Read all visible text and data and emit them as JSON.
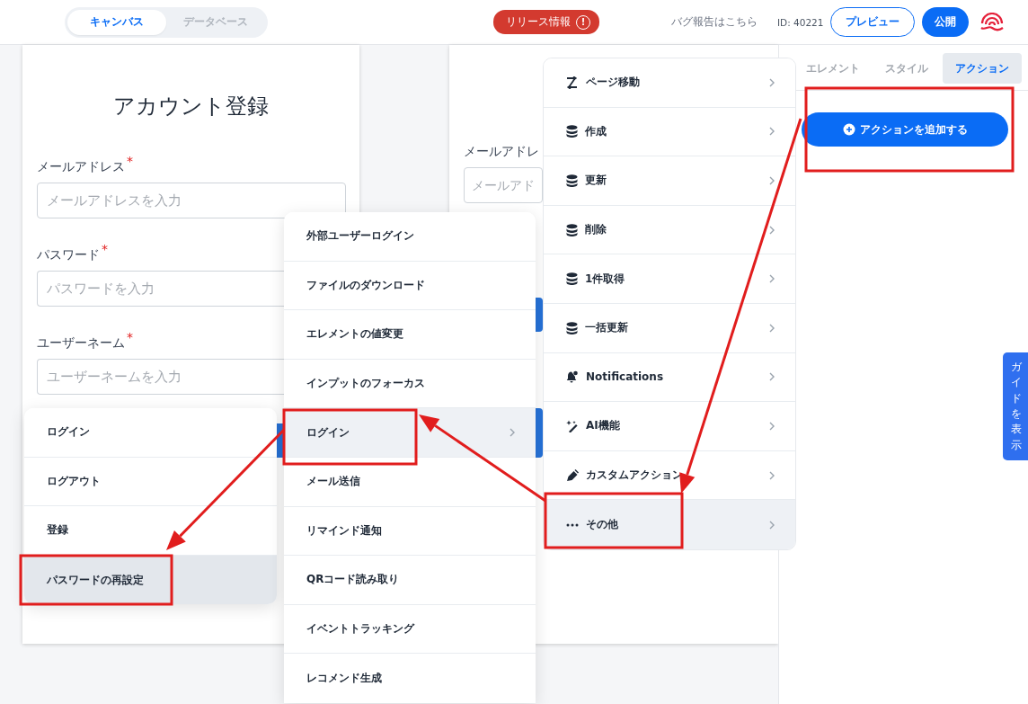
{
  "header": {
    "tabs": [
      {
        "label": "キャンバス",
        "selected": true
      },
      {
        "label": "データベース",
        "selected": false
      }
    ],
    "release_badge": {
      "label": "リリース情報",
      "icon": "!"
    },
    "bug_link": "バグ報告はこちら",
    "id_label": "ID: 40221",
    "buttons": [
      {
        "label": "プレビュー",
        "kind": "outline"
      },
      {
        "label": "公開",
        "kind": "primary"
      }
    ]
  },
  "canvas": {
    "form_card": {
      "title": "アカウント登録",
      "fields": [
        {
          "label": "メールアドレス",
          "required_mark": "*",
          "placeholder": "メールアドレスを入力"
        },
        {
          "label": "パスワード",
          "required_mark": "*",
          "placeholder": "パスワードを入力"
        },
        {
          "label": "ユーザーネーム",
          "required_mark": "*",
          "placeholder": "ユーザーネームを入力"
        }
      ]
    },
    "second_card": {
      "fields": [
        {
          "label": "メールアドレ",
          "placeholder": "メールアド"
        }
      ]
    }
  },
  "action_menu": {
    "items": [
      {
        "label": "ページ移動",
        "kind": "route",
        "selected": false
      },
      {
        "label": "作成",
        "kind": "database",
        "selected": false
      },
      {
        "label": "更新",
        "kind": "database",
        "selected": false
      },
      {
        "label": "削除",
        "kind": "database",
        "selected": false
      },
      {
        "label": "1件取得",
        "kind": "database",
        "selected": false
      },
      {
        "label": "一括更新",
        "kind": "database",
        "selected": false
      },
      {
        "label": "Notifications",
        "kind": "bell",
        "selected": false
      },
      {
        "label": "AI機能",
        "kind": "ai",
        "selected": false
      },
      {
        "label": "カスタムアクション",
        "kind": "custom",
        "selected": false
      },
      {
        "label": "その他",
        "kind": "more",
        "selected": true
      }
    ]
  },
  "submenu": {
    "items": [
      {
        "label": "外部ユーザーログイン",
        "selected": false,
        "has_submenu": false
      },
      {
        "label": "ファイルのダウンロード",
        "selected": false,
        "has_submenu": false
      },
      {
        "label": "エレメントの値変更",
        "selected": false,
        "has_submenu": false
      },
      {
        "label": "インプットのフォーカス",
        "selected": false,
        "has_submenu": false
      },
      {
        "label": "ログイン",
        "selected": true,
        "has_submenu": true
      },
      {
        "label": "メール送信",
        "selected": false,
        "has_submenu": false
      },
      {
        "label": "リマインド通知",
        "selected": false,
        "has_submenu": false
      },
      {
        "label": "QRコード読み取り",
        "selected": false,
        "has_submenu": false
      },
      {
        "label": "イベントトラッキング",
        "selected": false,
        "has_submenu": false
      },
      {
        "label": "レコメンド生成",
        "selected": false,
        "has_submenu": false
      }
    ]
  },
  "login_menu": {
    "items": [
      {
        "label": "ログイン",
        "selected": false
      },
      {
        "label": "ログアウト",
        "selected": false
      },
      {
        "label": "登録",
        "selected": false
      },
      {
        "label": "パスワードの再設定",
        "selected": true
      }
    ]
  },
  "right_panel": {
    "tabs": [
      {
        "label": "エレメント",
        "selected": false
      },
      {
        "label": "スタイル",
        "selected": false
      },
      {
        "label": "アクション",
        "selected": true
      }
    ],
    "add_action_button": "アクションを追加する",
    "guide_tab": "ガイドを表示"
  }
}
